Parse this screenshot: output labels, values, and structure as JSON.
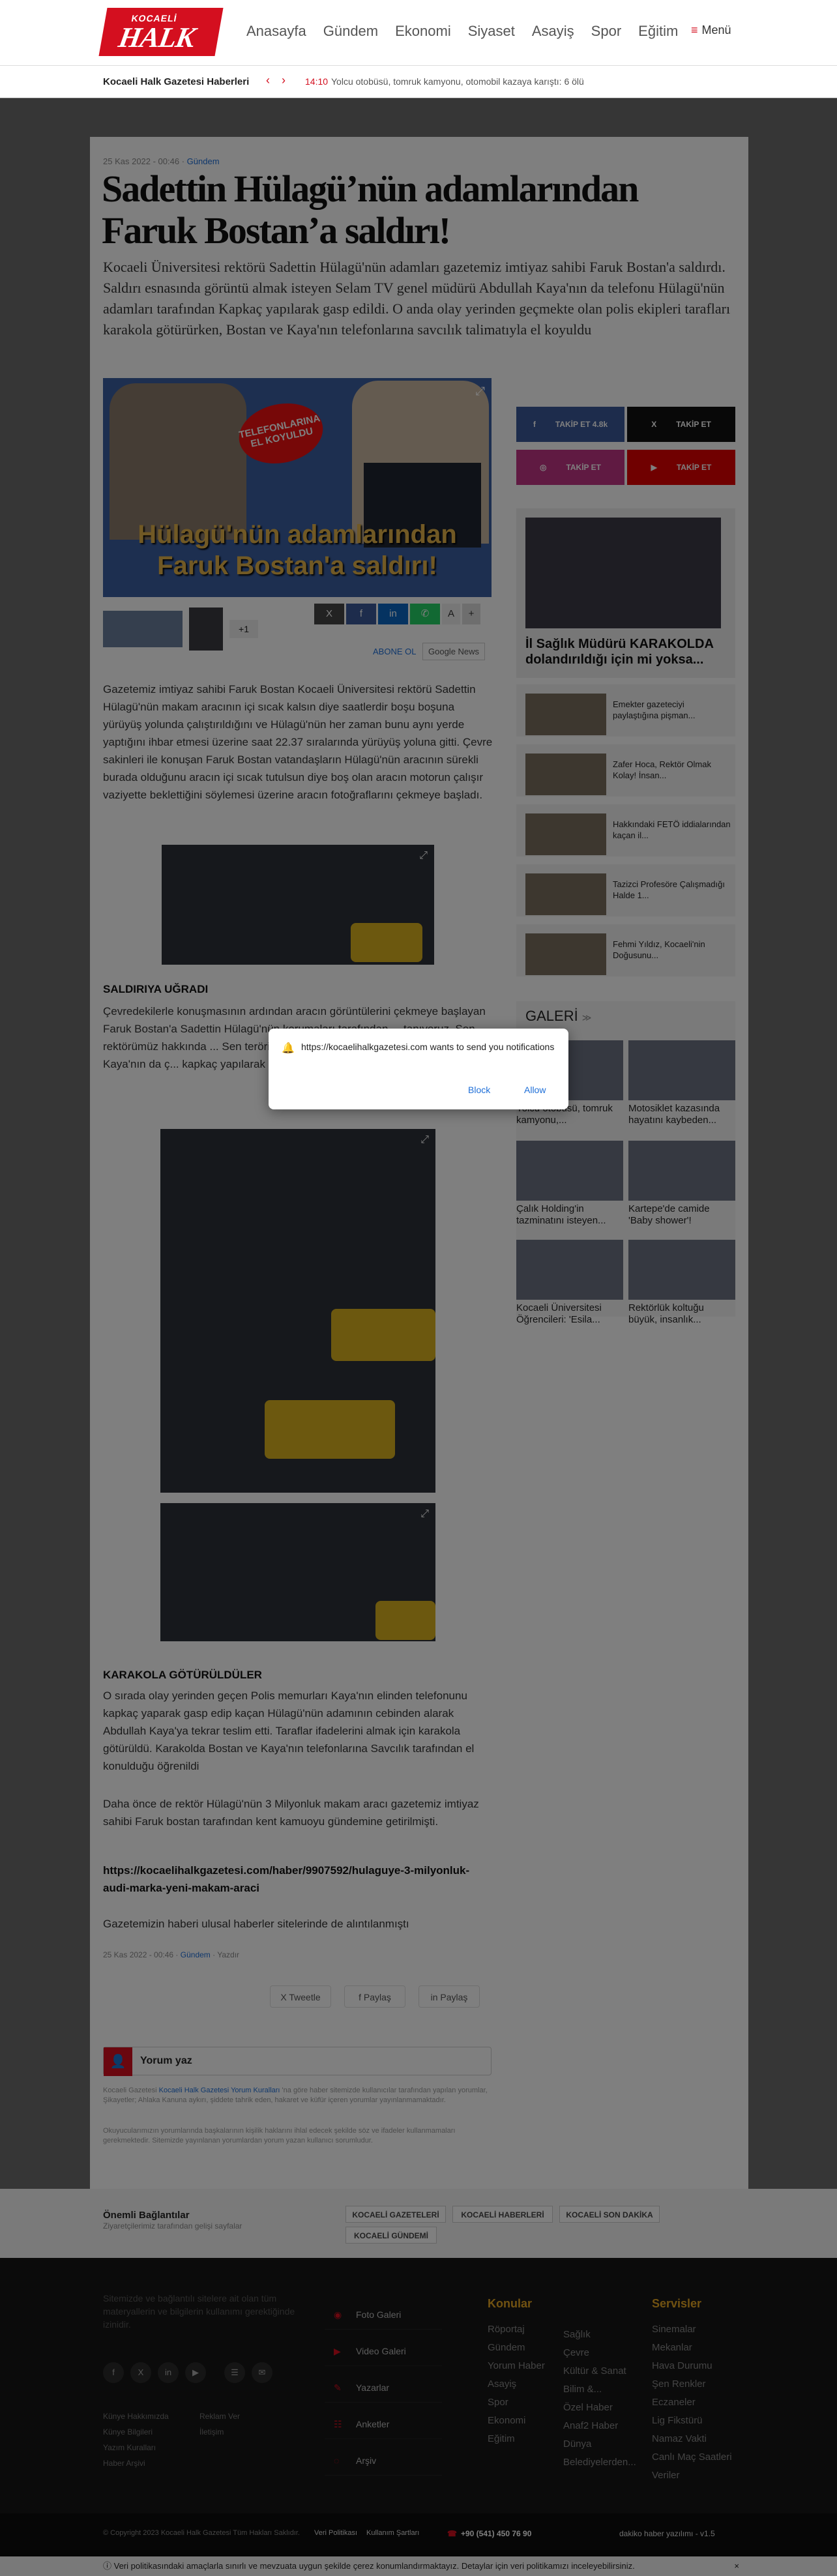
{
  "header": {
    "logo_top": "KOCAELİ",
    "logo_main": "HALK",
    "nav": [
      "Anasayfa",
      "Gündem",
      "Ekonomi",
      "Siyaset",
      "Asayiş",
      "Spor",
      "Eğitim"
    ],
    "menu_label": "Menü"
  },
  "ticker": {
    "title": "Kocaeli Halk Gazetesi Haberleri",
    "time": "14:10",
    "text": "Yolcu otobüsü, tomruk kamyonu, otomobil kazaya karıştı: 6 ölü"
  },
  "article": {
    "date": "25 Kas 2022 - 00:46",
    "category": "Gündem",
    "title": "Sadettin Hülagü’nün adamlarından Faruk Bostan’a saldırı!",
    "lead": "Kocaeli Üniversitesi rektörü Sadettin Hülagü'nün adamları gazetemiz imtiyaz sahibi Faruk Bostan'a saldırdı. Saldırı esnasında görüntü almak isteyen Selam TV genel müdürü Abdullah Kaya'nın da telefonu Hülagü'nün adamları tarafından Kapkaç yapılarak gasp edildi. O anda olay yerinden geçmekte olan polis ekipleri tarafları karakola götürürken, Bostan ve Kaya'nın telefonlarına savcılık talimatıyla el koyuldu",
    "image_badge": "TELEFONLARINA EL KOYULDU",
    "image_caption": "Hülagü'nün adamlarından Faruk Bostan'a saldırı!",
    "more_images": "+1",
    "share_buttons": [
      "X",
      "f",
      "in",
      "✆",
      "A",
      "+"
    ],
    "subscribe": "ABONE OL",
    "google_news": "Google News",
    "p1": "Gazetemiz imtiyaz sahibi Faruk Bostan Kocaeli Üniversitesi rektörü Sadettin Hülagü'nün makam aracının içi sıcak kalsın diye saatlerdir boşu boşuna yürüyüş yolunda çalıştırıldığını ve Hülagü'nün her zaman bunu aynı yerde yaptığını ihbar etmesi üzerine saat 22.37 sıralarında yürüyüş yoluna gitti. Çevre sakinleri ile konuşan Faruk Bostan vatandaşların Hülagü'nün aracının sürekli burada olduğunu aracın içi sıcak tutulsun diye boş olan aracın motorun çalışır vaziyette beklettiğini söylemesi üzerine aracın fotoğraflarını çekmeye başladı.",
    "h1": "SALDIRIYA UĞRADI",
    "p2": "Çevredekilerle konuşmasının ardından aracın görüntülerini çekmeye başlayan Faruk Bostan'a Sadettin Hülagü'nün korumaları tarafından ... tanıyoruz. Sen rektörümüz hakkında ... Sen teröristsin, PKK'lısın\" diye ... isteyen Abdullah Kaya'nın da ç... kapkaç yapılarak gasp edildi.",
    "h2": "KARAKOLA GÖTÜRÜLDÜLER",
    "p3": "O sırada olay yerinden geçen Polis memurları Kaya'nın elinden telefonunu kapkaç yaparak gasp edip kaçan Hülagü'nün adamının cebinden alarak Abdullah Kaya'ya tekrar teslim etti. Taraflar ifadelerini almak için karakola götürüldü. Karakolda Bostan ve Kaya'nın telefonlarına Savcılık tarafından el konulduğu öğrenildi",
    "p4": "Daha önce de rektör Hülagü'nün 3 Milyonluk makam aracı gazetemiz imtiyaz sahibi Faruk bostan tarafından kent kamuoyu gündemine getirilmişti.",
    "link": "https://kocaelihalkgazetesi.com/haber/9907592/hulaguye-3-milyonluk-audi-marka-yeni-makam-araci",
    "p5": "Gazetemizin haberi ulusal haberler sitelerinde de alıntılanmıştı",
    "foot_date": "25 Kas 2022 - 00:46",
    "foot_cat": "Gündem",
    "foot_comments": "Yazdır",
    "share_twitter": "Tweetle",
    "share_facebook": "Paylaş",
    "share_linkedin": "Paylaş",
    "comment_label": "Yorum yaz",
    "comment_note1_pre": "Kocaeli Gazetesi",
    "comment_note1_link": "Kocaeli Halk Gazetesi Yorum Kuralları",
    "comment_note1": "'na göre haber sitemizde kullanıcılar tarafından yapılan yorumlar, Şikayetler; Ahlaka Kanuna aykırı, şiddete tahrik eden, hakaret ve küfür içeren yorumlar yayınlanmamaktadır.",
    "comment_note2": "Okuyucularımızın yorumlarında başkalarının kişilik haklarını ihlal edecek şekilde söz ve ifadeler kullanmamaları gerekmektedir. Sitemizde yayınlanan yorumlardan yorum yazan kullanıcı sorumludur."
  },
  "sidebar": {
    "socials": [
      {
        "label": "TAKİP ET 4.8k",
        "icon": "f",
        "color": "#3b5998"
      },
      {
        "label": "TAKİP ET",
        "icon": "X",
        "color": "#111111"
      },
      {
        "label": "TAKİP ET",
        "icon": "◎",
        "color": "#c13584"
      },
      {
        "label": "TAKİP ET",
        "icon": "▶",
        "color": "#e00000"
      }
    ],
    "featured": "İl Sağlık Müdürü KARAKOLDA dolandırıldığı için mi yoksa...",
    "news": [
      "Emekter gazeteciyi paylaştığına pişman...",
      "Zafer Hoca, Rektör Olmak Kolay! İnsan...",
      "Hakkındaki FETÖ iddialarından kaçan il...",
      "Tazizci Profesöre Çalışmadığı Halde 1...",
      "Fehmi Yıldız, Kocaeli'nin Doğusunu..."
    ],
    "gallery_title": "GALERİ",
    "gallery_arrow": "≫",
    "gallery": [
      "Yolcu otobüsü, tomruk kamyonu,...",
      "Motosiklet kazasında hayatını kaybeden...",
      "Çalık Holding'in tazminatını isteyen...",
      "Kartepe'de camide 'Baby shower'!",
      "Kocaeli Üniversitesi Öğrencileri: 'Esila...",
      "Rektörlük koltuğu büyük, insanlık..."
    ]
  },
  "tags": {
    "title": "Önemli Bağlantılar",
    "subtitle": "Ziyaretçilerimiz tarafından gelişi sayfalar",
    "items": [
      "KOCAELİ GAZETELERİ",
      "KOCAELİ HABERLERİ",
      "KOCAELİ SON DAKİKA",
      "KOCAELİ GÜNDEMİ"
    ]
  },
  "footer": {
    "about": "Sitemizde ve bağlantılı sitelere ait olan tüm materyallerin ve bilgilerin kullanımı gerektiğinde izinidir.",
    "social_icons": [
      "f",
      "X",
      "in",
      "▶",
      "☰",
      "✉"
    ],
    "links": [
      "Künye Hakkımızda",
      "Reklam Ver",
      "Künye Bilgileri",
      "İletişim",
      "Yazım Kuralları",
      "Haber Arşivi"
    ],
    "menu": [
      {
        "icon": "◉",
        "label": "Foto Galeri"
      },
      {
        "icon": "▶",
        "label": "Video Galeri"
      },
      {
        "icon": "✎",
        "label": "Yazarlar"
      },
      {
        "icon": "☷",
        "label": "Anketler"
      },
      {
        "icon": "◌",
        "label": "Arşiv"
      }
    ],
    "konular_title": "Konular",
    "konular_a": [
      "Röportaj",
      "Gündem",
      "Yorum Haber",
      "Asayiş",
      "Spor",
      "Ekonomi",
      "Eğitim"
    ],
    "konular_b": [
      "Sağlık",
      "Çevre",
      "Kültür & Sanat",
      "Bilim &...",
      "Özel Haber",
      "Anaf2 Haber",
      "Dünya",
      "Belediyelerden..."
    ],
    "servisler_title": "Servisler",
    "servisler": [
      "Sinemalar",
      "Mekanlar",
      "Hava Durumu",
      "Şen Renkler",
      "Eczaneler",
      "Lig Fikstürü",
      "Namaz Vakti",
      "Canlı Maç Saatleri",
      "Veriler"
    ]
  },
  "bottombar": {
    "copyright": "© Copyright 2023 Kocaeli Halk Gazetesi Tüm Hakları Saklıdır.",
    "privacy": "Veri Politikası",
    "terms": "Kullanım Şartları",
    "phone": "+90 (541) 450 76 90",
    "dev": "dakiko haber yazılımı - v1.5"
  },
  "cookie": {
    "text": "Veri politikasındaki amaçlarla sınırlı ve mevzuata uygun şekilde çerez konumlandırmaktayız. Detaylar için veri politikamızı inceleyebilirsiniz.",
    "close": "×"
  },
  "dialog": {
    "message": "https://kocaelihalkgazetesi.com wants to send you notifications",
    "block": "Block",
    "allow": "Allow"
  }
}
